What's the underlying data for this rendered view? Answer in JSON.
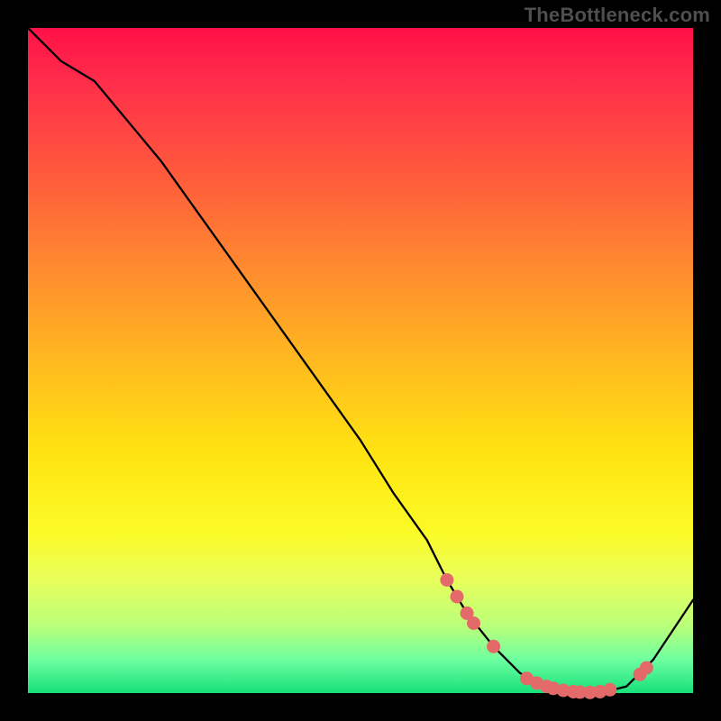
{
  "watermark": "TheBottleneck.com",
  "chart_data": {
    "type": "line",
    "title": "",
    "xlabel": "",
    "ylabel": "",
    "xlim": [
      0,
      100
    ],
    "ylim": [
      0,
      100
    ],
    "grid": false,
    "legend": false,
    "series": [
      {
        "name": "bottleneck-curve",
        "x": [
          0,
          5,
          10,
          15,
          20,
          25,
          30,
          35,
          40,
          45,
          50,
          55,
          60,
          63,
          66,
          70,
          74,
          78,
          82,
          86,
          90,
          94,
          100
        ],
        "y": [
          100,
          95,
          92,
          86,
          80,
          73,
          66,
          59,
          52,
          45,
          38,
          30,
          23,
          17,
          12,
          7,
          3,
          1,
          0,
          0,
          1,
          5,
          14
        ]
      }
    ],
    "markers": {
      "name": "highlighted-points",
      "color": "#e46a6a",
      "points": [
        {
          "x": 63,
          "y": 17
        },
        {
          "x": 64.5,
          "y": 14.5
        },
        {
          "x": 66,
          "y": 12
        },
        {
          "x": 67,
          "y": 10.5
        },
        {
          "x": 70,
          "y": 7
        },
        {
          "x": 75,
          "y": 2.2
        },
        {
          "x": 76.5,
          "y": 1.5
        },
        {
          "x": 78,
          "y": 1.0
        },
        {
          "x": 79,
          "y": 0.7
        },
        {
          "x": 80.5,
          "y": 0.4
        },
        {
          "x": 82,
          "y": 0.2
        },
        {
          "x": 83,
          "y": 0.15
        },
        {
          "x": 84.5,
          "y": 0.1
        },
        {
          "x": 86,
          "y": 0.2
        },
        {
          "x": 87.5,
          "y": 0.5
        },
        {
          "x": 92,
          "y": 2.8
        },
        {
          "x": 93,
          "y": 3.8
        }
      ]
    },
    "background_gradient": {
      "direction": "vertical",
      "stops": [
        {
          "pos": 0.0,
          "color": "#ff1147"
        },
        {
          "pos": 0.5,
          "color": "#ffb91f"
        },
        {
          "pos": 0.8,
          "color": "#fbfb27"
        },
        {
          "pos": 1.0,
          "color": "#17e07b"
        }
      ]
    }
  }
}
